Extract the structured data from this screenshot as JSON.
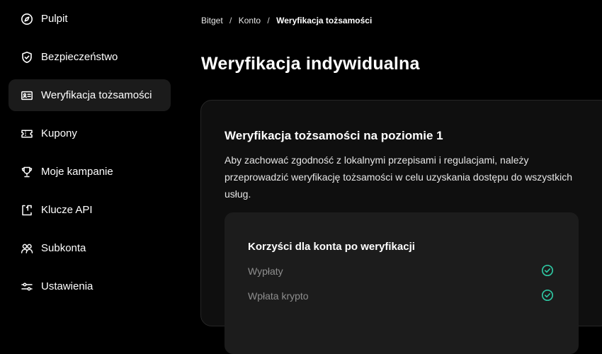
{
  "sidebar": {
    "items": [
      {
        "label": "Pulpit",
        "icon": "dashboard-compass-icon",
        "active": false
      },
      {
        "label": "Bezpieczeństwo",
        "icon": "shield-check-icon",
        "active": false
      },
      {
        "label": "Weryfikacja tożsamości",
        "icon": "id-card-icon",
        "active": true
      },
      {
        "label": "Kupony",
        "icon": "coupon-ticket-icon",
        "active": false
      },
      {
        "label": "Moje kampanie",
        "icon": "trophy-icon",
        "active": false
      },
      {
        "label": "Klucze API",
        "icon": "api-key-icon",
        "active": false
      },
      {
        "label": "Subkonta",
        "icon": "users-icon",
        "active": false
      },
      {
        "label": "Ustawienia",
        "icon": "sliders-icon",
        "active": false
      }
    ]
  },
  "breadcrumb": {
    "items": [
      "Bitget",
      "Konto",
      "Weryfikacja tożsamości"
    ],
    "separator": "/"
  },
  "page": {
    "title": "Weryfikacja indywidualna"
  },
  "card": {
    "title": "Weryfikacja tożsamości na poziomie 1",
    "description": "Aby zachować zgodność z lokalnymi przepisami i regulacjami, należy przeprowadzić weryfikację tożsamości w celu uzyskania dostępu do wszystkich usług."
  },
  "benefits": {
    "title": "Korzyści dla konta po weryfikacji",
    "items": [
      {
        "label": "Wypłaty",
        "icon": "check-circle-icon"
      },
      {
        "label": "Wpłata krypto",
        "icon": "check-circle-icon"
      }
    ]
  },
  "colors": {
    "background": "#000000",
    "active_nav": "#1b1b1b",
    "card": "#0f0f0f",
    "benefits_panel": "#1c1c1c",
    "check": "#2ec4a0",
    "muted_text": "#8e8e8e"
  }
}
